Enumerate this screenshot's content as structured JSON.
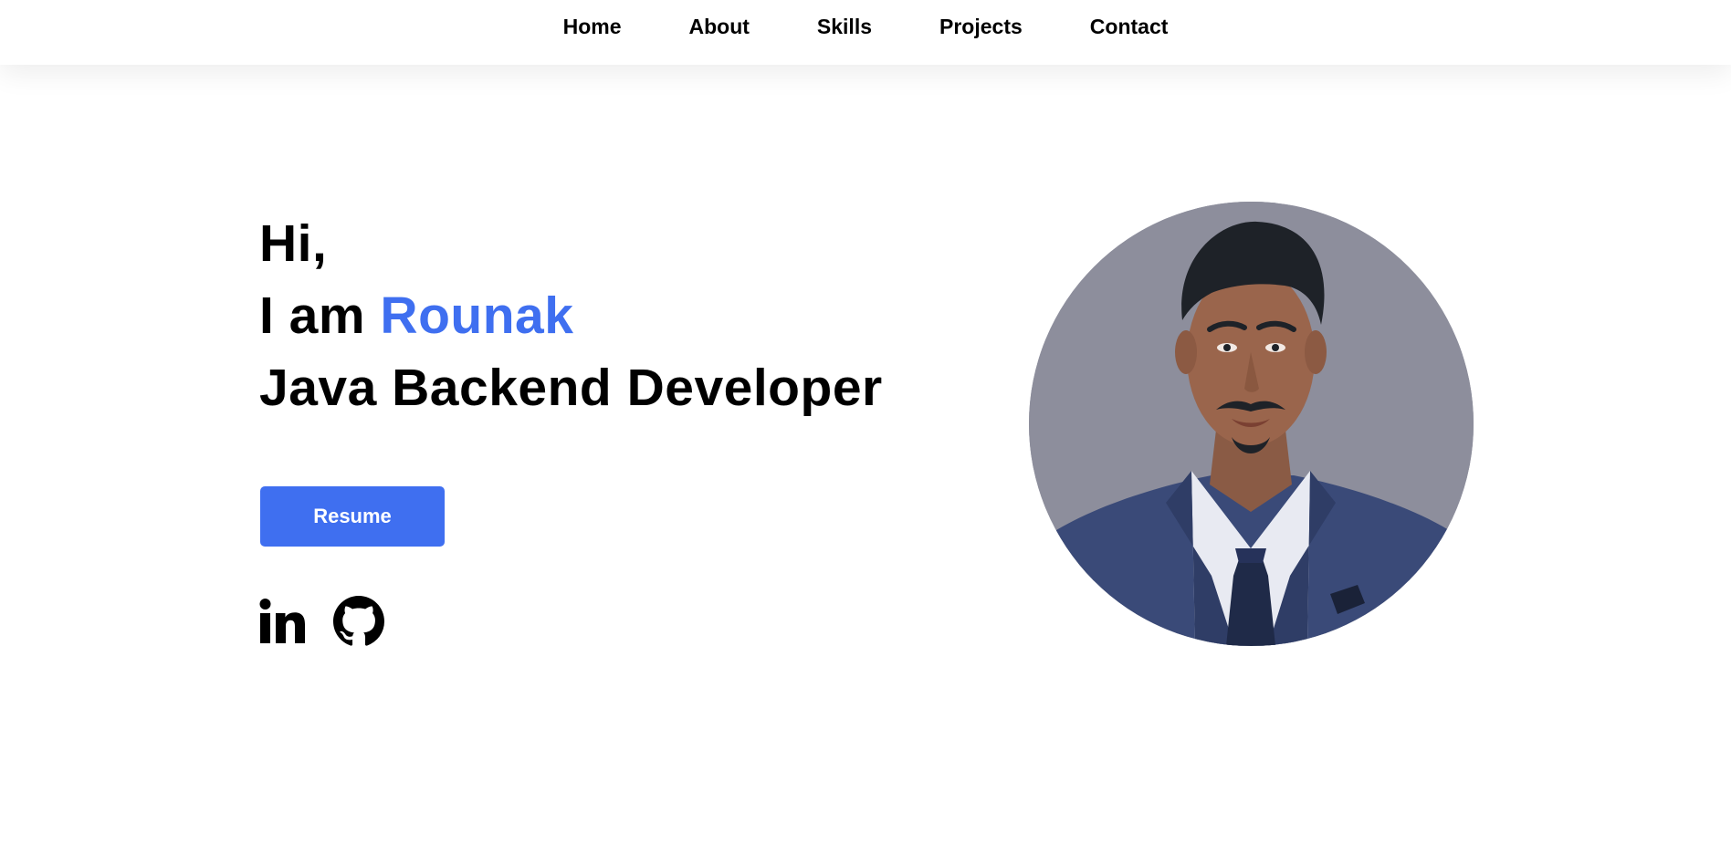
{
  "nav": {
    "items": [
      {
        "label": "Home"
      },
      {
        "label": "About"
      },
      {
        "label": "Skills"
      },
      {
        "label": "Projects"
      },
      {
        "label": "Contact"
      }
    ]
  },
  "hero": {
    "greeting": "Hi,",
    "intro_prefix": "I am ",
    "name": "Rounak",
    "role": "Java Backend Developer",
    "resume_label": "Resume"
  },
  "socials": [
    {
      "icon": "linkedin-icon"
    },
    {
      "icon": "github-icon"
    }
  ],
  "colors": {
    "accent": "#3f6ff0",
    "text": "#000000",
    "background": "#ffffff",
    "photo_background": "#8d8e9c",
    "suit": "#3a4a78"
  }
}
